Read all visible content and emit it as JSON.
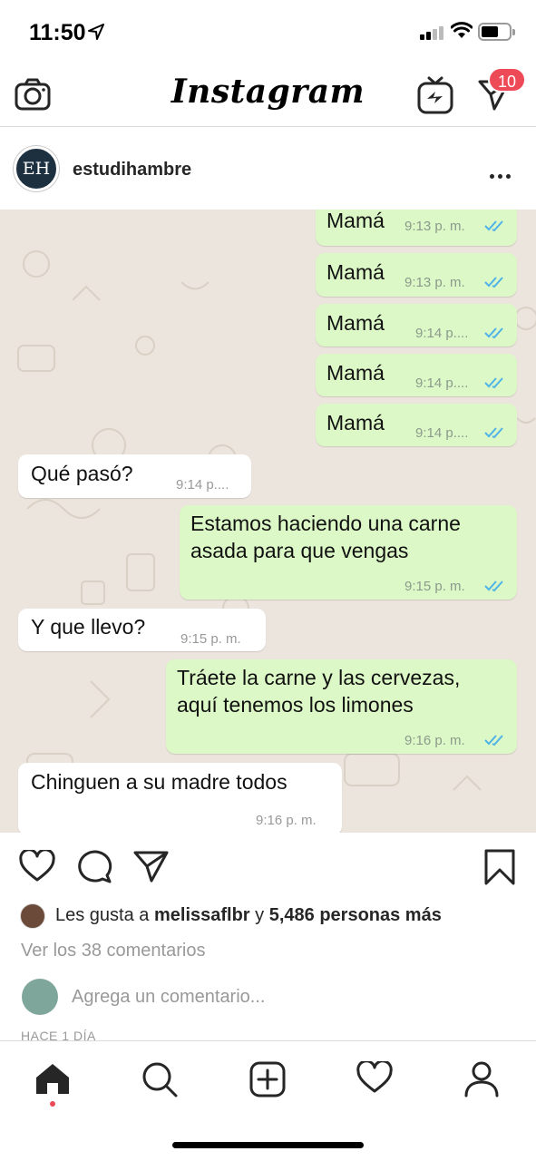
{
  "status_bar": {
    "time": "11:50"
  },
  "top_nav": {
    "logo": "Instagram",
    "dm_badge": "10"
  },
  "post": {
    "avatar_text": "EH",
    "username": "estudihambre"
  },
  "chat": {
    "messages": [
      {
        "dir": "out",
        "text": "Mamá",
        "time": "9:13 p. m."
      },
      {
        "dir": "out",
        "text": "Mamá",
        "time": "9:13 p. m."
      },
      {
        "dir": "out",
        "text": "Mamá",
        "time": "9:14 p...."
      },
      {
        "dir": "out",
        "text": "Mamá",
        "time": "9:14 p...."
      },
      {
        "dir": "out",
        "text": "Mamá",
        "time": "9:14 p...."
      },
      {
        "dir": "in",
        "text": "Qué pasó?",
        "time": "9:14 p...."
      },
      {
        "dir": "out",
        "text_line1": "Estamos haciendo una carne",
        "text_line2": "asada para que vengas",
        "time": "9:15 p. m."
      },
      {
        "dir": "in",
        "text": "Y que llevo?",
        "time": "9:15 p. m."
      },
      {
        "dir": "out",
        "text_line1": "Tráete la carne y las cervezas,",
        "text_line2": "aquí tenemos los limones",
        "time": "9:16 p. m."
      },
      {
        "dir": "in",
        "text": "Chinguen a su madre todos",
        "time": "9:16 p. m."
      }
    ]
  },
  "engagement": {
    "likes_prefix": "Les gusta a",
    "liked_by": "melissaflbr",
    "likes_and": "y",
    "likes_count": "5,486 personas más",
    "view_comments": "Ver los 38 comentarios",
    "add_comment_placeholder": "Agrega un comentario...",
    "time_ago": "HACE 1 DÍA"
  }
}
